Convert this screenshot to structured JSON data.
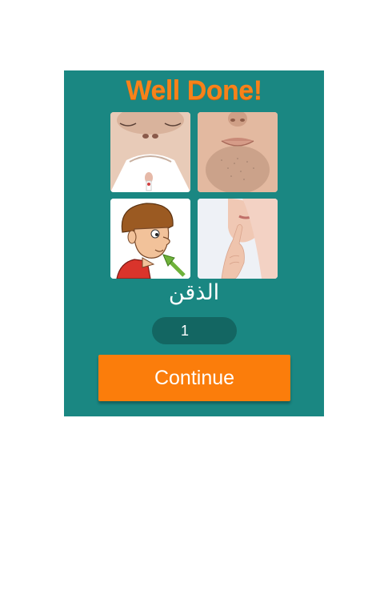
{
  "result": {
    "title": "Well Done!"
  },
  "puzzle": {
    "images": [
      {
        "icon": "chin-from-below-photo"
      },
      {
        "icon": "stubbled-chin-photo"
      },
      {
        "icon": "cartoon-chin-arrow-illustration"
      },
      {
        "icon": "finger-on-chin-photo"
      }
    ],
    "answer_word": "الذقن",
    "level": "1"
  },
  "actions": {
    "continue_label": "Continue"
  },
  "colors": {
    "panel": "#1a8782",
    "accent": "#f7821a",
    "button": "#fb7d0b"
  }
}
